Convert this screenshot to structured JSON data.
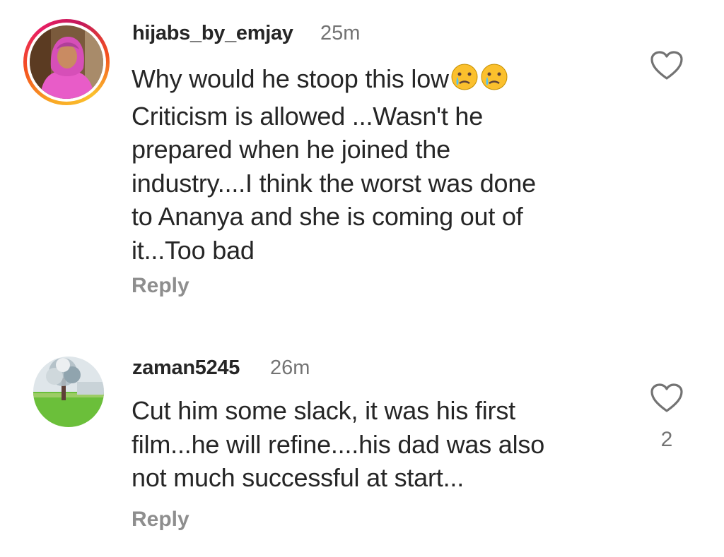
{
  "comments": [
    {
      "username": "hijabs_by_emjay",
      "time": "25m",
      "lines": [
        "Why would he stoop this low",
        "Criticism is allowed ...Wasn't he",
        "prepared when he joined the",
        "industry....I think the worst was done",
        "to Ananya and she is coming out of",
        "it...Too bad"
      ],
      "emojis": [
        "crying-face",
        "crying-face"
      ],
      "reply_label": "Reply",
      "likes": "",
      "avatar_ring": true
    },
    {
      "username": "zaman5245",
      "time": "26m",
      "lines": [
        "Cut him some slack, it was his first",
        "film...he will refine....his dad was also",
        "not much successful at start..."
      ],
      "reply_label": "Reply",
      "likes": "2",
      "avatar_ring": false
    }
  ],
  "colors": {
    "text": "#262626",
    "secondary": "#737373",
    "reply": "#8e8e8e",
    "story_ring": [
      "#f9a825",
      "#e91e63"
    ]
  },
  "icons": [
    "heart-outline-icon",
    "crying-face-emoji"
  ]
}
